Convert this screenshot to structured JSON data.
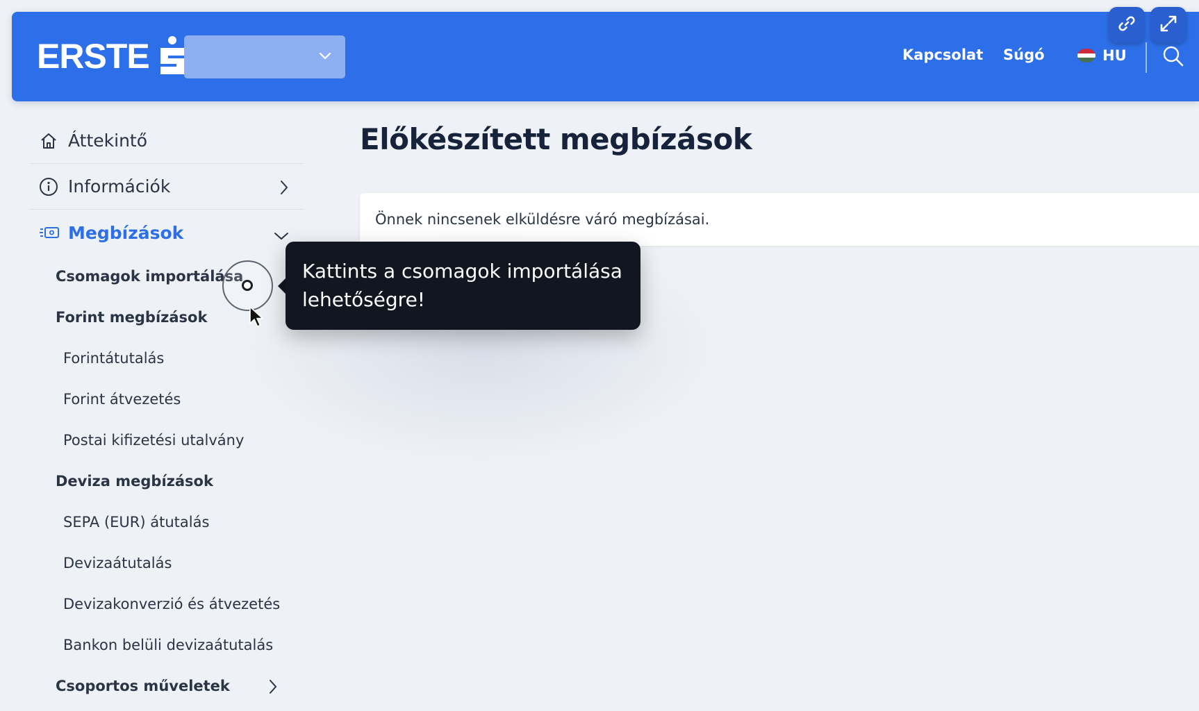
{
  "header": {
    "brand": "ERSTE",
    "account_select_value": "",
    "links": {
      "contact": "Kapcsolat",
      "help": "Súgó"
    },
    "language": "HU",
    "brand_color": "#2d6fe8"
  },
  "overlay_buttons": {
    "copy_link_icon": "link-icon",
    "fullscreen_icon": "expand-icon"
  },
  "sidebar": {
    "overview": "Áttekintő",
    "info": "Információk",
    "orders": "Megbízások",
    "groups": [
      {
        "label": "Csomagok importálása",
        "items": []
      },
      {
        "label": "Forint megbízások",
        "items": [
          "Forintátutalás",
          "Forint átvezetés",
          "Postai kifizetési utalvány"
        ]
      },
      {
        "label": "Deviza megbízások",
        "items": [
          "SEPA (EUR) átutalás",
          "Devizaátutalás",
          "Devizakonverzió és átvezetés",
          "Bankon belüli devizaátutalás"
        ]
      },
      {
        "label": "Csoportos műveletek",
        "items": []
      }
    ]
  },
  "main": {
    "title": "Előkészített megbízások",
    "empty_message": "Önnek nincsenek elküldésre váró megbízásai."
  },
  "tooltip": {
    "line1": "Kattints a csomagok importálása",
    "line2": "lehetőségre!"
  }
}
